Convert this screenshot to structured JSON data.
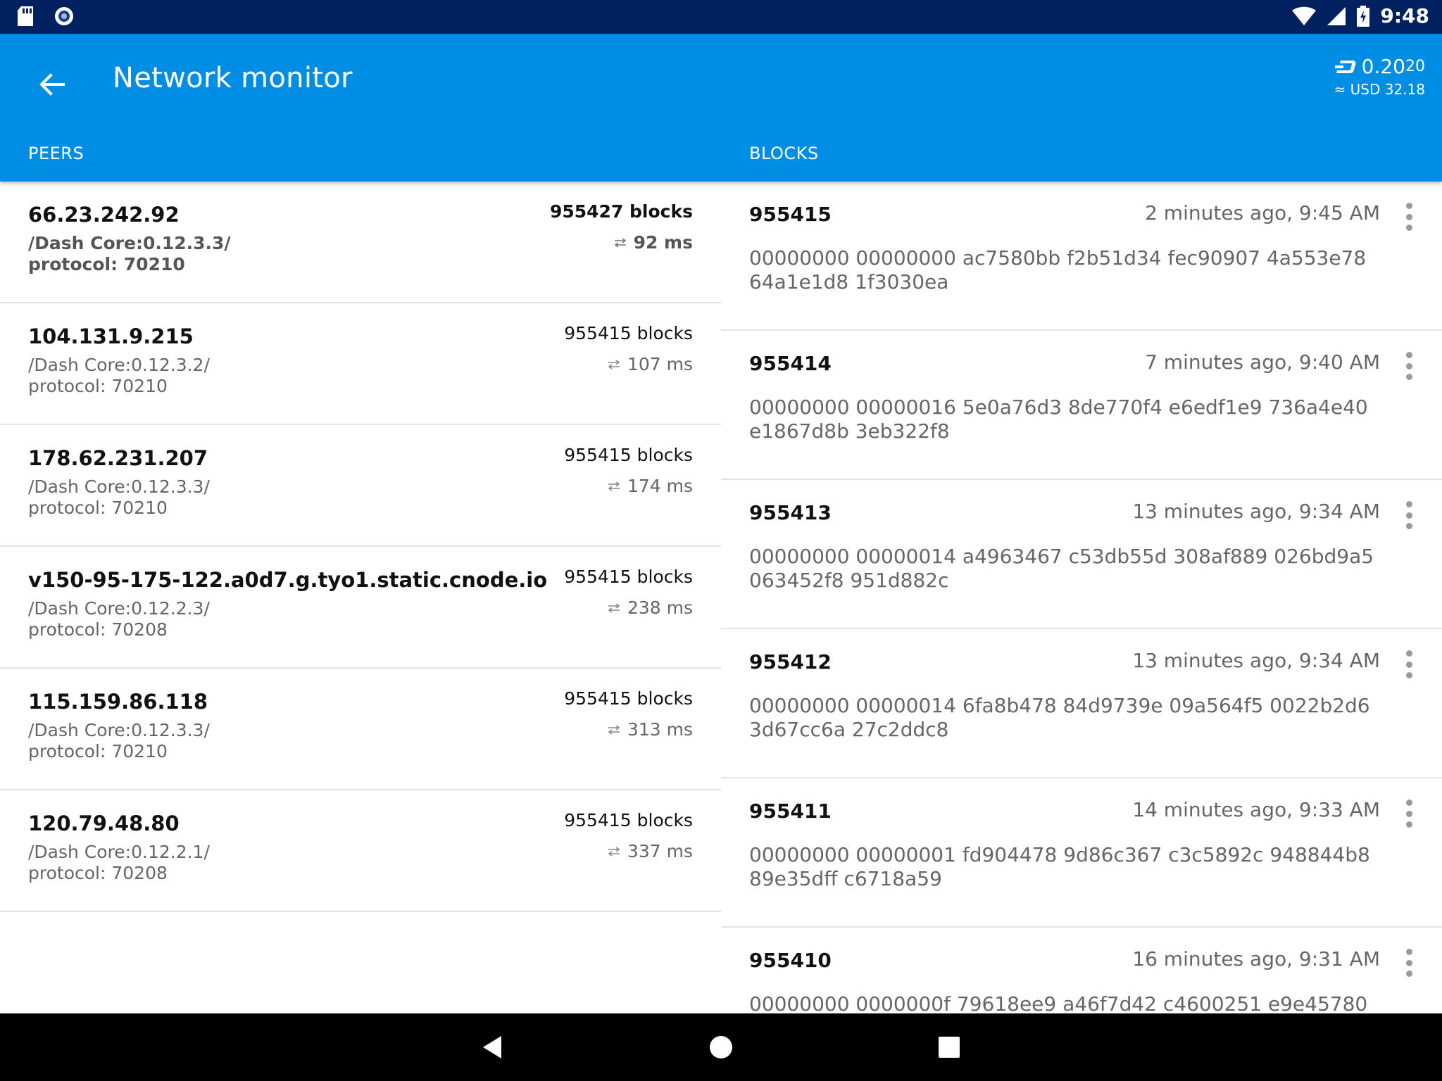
{
  "status_bar": {
    "time": "9:48"
  },
  "app_bar": {
    "title": "Network monitor",
    "balance": {
      "main": "0.20",
      "small": "20",
      "fiat_label": "≈ USD",
      "fiat_value": "32.18"
    }
  },
  "tabs": {
    "peers": "PEERS",
    "blocks": "BLOCKS"
  },
  "peers": [
    {
      "host": "66.23.242.92",
      "version": "/Dash Core:0.12.3.3/",
      "protocol": "protocol: 70210",
      "height": "955427 blocks",
      "ping": "92 ms"
    },
    {
      "host": "104.131.9.215",
      "version": "/Dash Core:0.12.3.2/",
      "protocol": "protocol: 70210",
      "height": "955415 blocks",
      "ping": "107 ms"
    },
    {
      "host": "178.62.231.207",
      "version": "/Dash Core:0.12.3.3/",
      "protocol": "protocol: 70210",
      "height": "955415 blocks",
      "ping": "174 ms"
    },
    {
      "host": "v150-95-175-122.a0d7.g.tyo1.static.cnode.io",
      "version": "/Dash Core:0.12.2.3/",
      "protocol": "protocol: 70208",
      "height": "955415 blocks",
      "ping": "238 ms"
    },
    {
      "host": "115.159.86.118",
      "version": "/Dash Core:0.12.3.3/",
      "protocol": "protocol: 70210",
      "height": "955415 blocks",
      "ping": "313 ms"
    },
    {
      "host": "120.79.48.80",
      "version": "/Dash Core:0.12.2.1/",
      "protocol": "protocol: 70208",
      "height": "955415 blocks",
      "ping": "337 ms"
    }
  ],
  "blocks": [
    {
      "height": "955415",
      "time": "2 minutes ago, 9:45 AM",
      "hash": "00000000 00000000 ac7580bb f2b51d34 fec90907 4a553e78 64a1e1d8 1f3030ea"
    },
    {
      "height": "955414",
      "time": "7 minutes ago, 9:40 AM",
      "hash": "00000000 00000016 5e0a76d3 8de770f4 e6edf1e9 736a4e40 e1867d8b 3eb322f8"
    },
    {
      "height": "955413",
      "time": "13 minutes ago, 9:34 AM",
      "hash": "00000000 00000014 a4963467 c53db55d 308af889 026bd9a5 063452f8 951d882c"
    },
    {
      "height": "955412",
      "time": "13 minutes ago, 9:34 AM",
      "hash": "00000000 00000014 6fa8b478 84d9739e 09a564f5 0022b2d6 3d67cc6a 27c2ddc8"
    },
    {
      "height": "955411",
      "time": "14 minutes ago, 9:33 AM",
      "hash": "00000000 00000001 fd904478 9d86c367 c3c5892c 948844b8 89e35dff c6718a59"
    },
    {
      "height": "955410",
      "time": "16 minutes ago, 9:31 AM",
      "hash": "00000000 0000000f 79618ee9 a46f7d42 c4600251 e9e45780"
    }
  ],
  "colors": {
    "status_bar": "#012060",
    "app_bar": "#008de4",
    "nav_bar": "#000000",
    "divider": "#e4e4e4"
  },
  "icons": [
    "sd-card-icon",
    "sync-icon",
    "wifi-icon",
    "signal-icon",
    "battery-icon",
    "back-arrow-icon",
    "dash-logo-icon",
    "ping-arrows-icon",
    "more-vert-icon",
    "nav-back-icon",
    "nav-home-icon",
    "nav-recents-icon"
  ]
}
